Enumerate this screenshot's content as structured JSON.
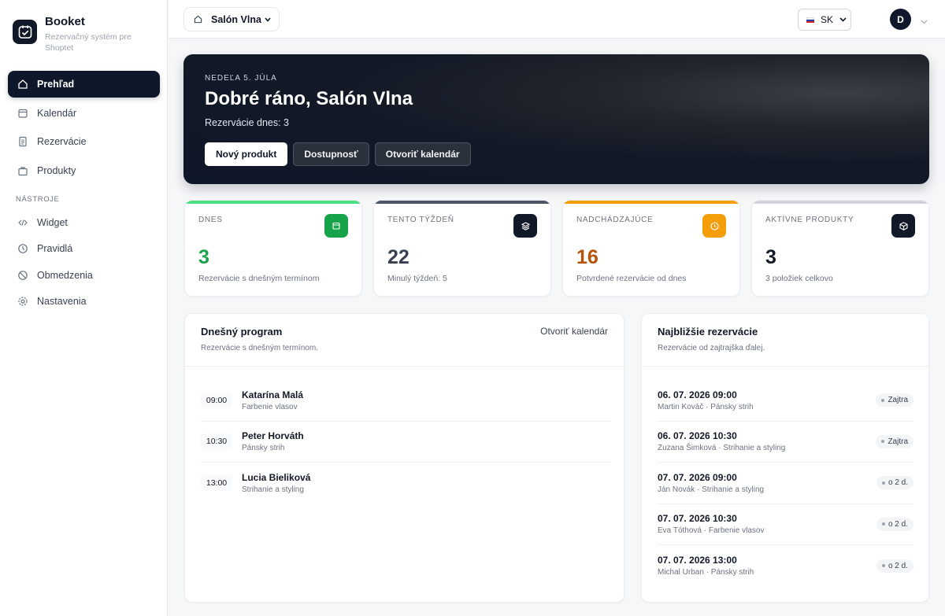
{
  "brand": {
    "name": "Booket",
    "subtitle": "Rezervačný systém pre Shoptet"
  },
  "sidebar": {
    "items": [
      {
        "label": "Prehľad",
        "icon": "home-icon",
        "active": true
      },
      {
        "label": "Kalendár",
        "icon": "calendar-icon"
      },
      {
        "label": "Rezervácie",
        "icon": "document-icon"
      },
      {
        "label": "Produkty",
        "icon": "bag-icon"
      }
    ],
    "tools_label": "NÁSTROJE",
    "tools": [
      {
        "label": "Widget",
        "icon": "code-icon"
      },
      {
        "label": "Pravidlá",
        "icon": "clock-icon"
      },
      {
        "label": "Obmedzenia",
        "icon": "ban-icon"
      },
      {
        "label": "Nastavenia",
        "icon": "gear-icon"
      }
    ]
  },
  "topbar": {
    "store": "Salón Vlna",
    "language": "SK",
    "avatar_initial": "D"
  },
  "hero": {
    "date": "NEDEĽA 5. JÚLA",
    "title": "Dobré ráno, Salón Vlna",
    "subtitle": "Rezervácie dnes: 3",
    "buttons": {
      "new_product": "Nový produkt",
      "availability": "Dostupnosť",
      "open_calendar": "Otvoriť kalendár"
    }
  },
  "stats": [
    {
      "label": "DNES",
      "value": "3",
      "note": "Rezervácie s dnešným termínom",
      "color": "#16a34a",
      "bar": "#4ade80",
      "icon": "calendar-icon"
    },
    {
      "label": "TENTO TÝŽDEŇ",
      "value": "22",
      "note": "Minulý týždeň: 5",
      "color": "#374151",
      "bar": "#4b5563",
      "icon": "layers-icon"
    },
    {
      "label": "NADCHÁDZAJÚCE",
      "value": "16",
      "note": "Potvrdené rezervácie od dnes",
      "color": "#b45309",
      "bar": "#f59e0b",
      "icon": "clock-icon"
    },
    {
      "label": "AKTÍVNE PRODUKTY",
      "value": "3",
      "note": "3 položiek celkovo",
      "color": "#111827",
      "bar": "#d1d5db",
      "icon": "box-icon"
    }
  ],
  "program": {
    "title": "Dnešný program",
    "subtitle": "Rezervácie s dnešným termínom.",
    "link": "Otvoriť kalendár",
    "rows": [
      {
        "time": "09:00",
        "name": "Katarína Malá",
        "service": "Farbenie vlasov"
      },
      {
        "time": "10:30",
        "name": "Peter Horváth",
        "service": "Pánsky strih"
      },
      {
        "time": "13:00",
        "name": "Lucia Bieliková",
        "service": "Strihanie a styling"
      }
    ]
  },
  "upcoming": {
    "title": "Najbližšie rezervácie",
    "subtitle": "Rezervácie od zajtrajška ďalej.",
    "rows": [
      {
        "datetime": "06. 07. 2026 09:00",
        "detail": "Martin Kováč · Pánsky strih",
        "badge": "Zajtra"
      },
      {
        "datetime": "06. 07. 2026 10:30",
        "detail": "Zuzana Šimková · Strihanie a styling",
        "badge": "Zajtra"
      },
      {
        "datetime": "07. 07. 2026 09:00",
        "detail": "Ján Novák · Strihanie a styling",
        "badge": "o 2 d."
      },
      {
        "datetime": "07. 07. 2026 10:30",
        "detail": "Eva Tóthová · Farbenie vlasov",
        "badge": "o 2 d."
      },
      {
        "datetime": "07. 07. 2026 13:00",
        "detail": "Michal Urban · Pánsky strih",
        "badge": "o 2 d."
      }
    ]
  }
}
